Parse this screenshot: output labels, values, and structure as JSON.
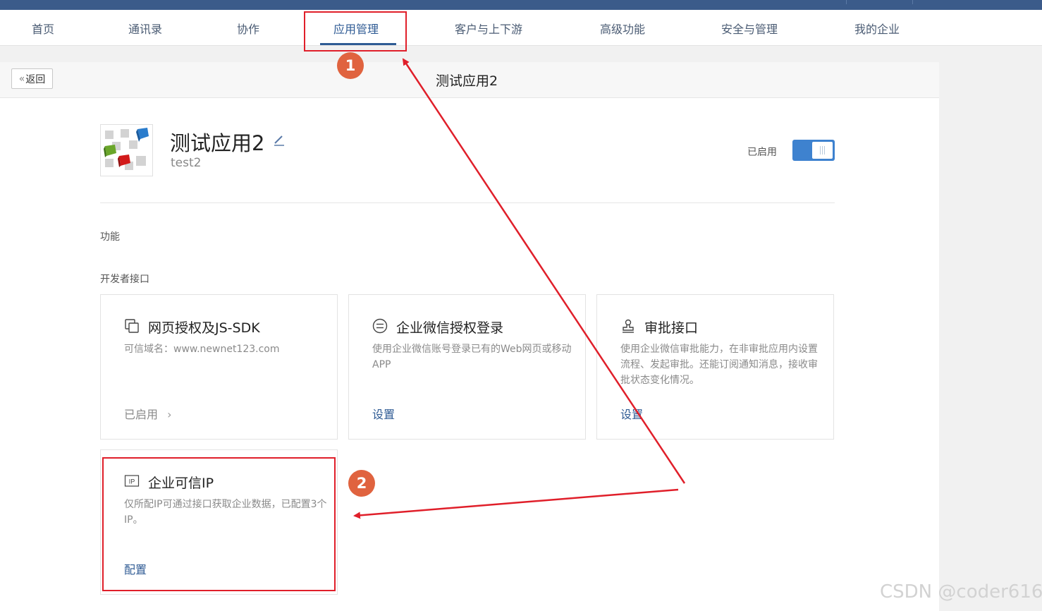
{
  "nav": {
    "items": [
      {
        "label": "首页"
      },
      {
        "label": "通讯录"
      },
      {
        "label": "协作"
      },
      {
        "label": "应用管理",
        "active": true
      },
      {
        "label": "客户与上下游"
      },
      {
        "label": "高级功能"
      },
      {
        "label": "安全与管理"
      },
      {
        "label": "我的企业"
      }
    ]
  },
  "header": {
    "back_label": "返回",
    "title": "测试应用2"
  },
  "app": {
    "name": "测试应用2",
    "code": "test2",
    "status_label": "已启用",
    "enabled": true
  },
  "sections": {
    "features": "功能",
    "developer": "开发者接口"
  },
  "cards": [
    {
      "icon": "copy-icon",
      "title": "网页授权及JS-SDK",
      "desc": "可信域名：www.newnet123.com",
      "action": "已启用"
    },
    {
      "icon": "menu-circle-icon",
      "title": "企业微信授权登录",
      "desc": "使用企业微信账号登录已有的Web网页或移动APP",
      "action": "设置"
    },
    {
      "icon": "stamp-icon",
      "title": "审批接口",
      "desc": "使用企业微信审批能力，在非审批应用内设置流程、发起审批。还能订阅通知消息，接收审批状态变化情况。",
      "action": "设置"
    },
    {
      "icon": "ip-icon",
      "title": "企业可信IP",
      "desc": "仅所配IP可通过接口获取企业数据，已配置3个IP。",
      "action": "配置"
    }
  ],
  "annotations": {
    "badge1": "1",
    "badge2": "2",
    "color": "#e01f2a",
    "badge_color": "#e0633f"
  },
  "watermark": "CSDN @coder616"
}
